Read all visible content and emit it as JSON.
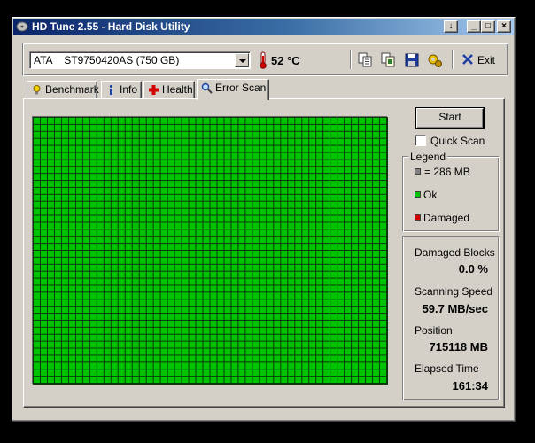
{
  "window": {
    "title": "HD Tune 2.55 - Hard Disk Utility",
    "title_buttons": [
      "↓",
      "_",
      "□",
      "×"
    ]
  },
  "toolbar": {
    "drive": "ATA    ST9750420AS (750 GB)",
    "temperature": "52 °C",
    "exit_label": "Exit",
    "icons": [
      "copy-text-icon",
      "copy-info-icon",
      "save-icon",
      "options-icon",
      "exit-icon"
    ]
  },
  "tabs": [
    {
      "label": "Benchmark",
      "icon": "benchmark-icon",
      "active": false
    },
    {
      "label": "Info",
      "icon": "info-icon",
      "active": false
    },
    {
      "label": "Health",
      "icon": "health-cross-icon",
      "active": false
    },
    {
      "label": "Error Scan",
      "icon": "magnifier-icon",
      "active": true
    }
  ],
  "scan": {
    "start_label": "Start",
    "quick_scan_label": "Quick Scan",
    "quick_scan_checked": false,
    "grid": {
      "columns": 50,
      "rows": 38,
      "status": "Ok",
      "block_color": "#00c400"
    }
  },
  "legend": {
    "title": "Legend",
    "items": [
      {
        "label": "= 286 MB",
        "color": "#808080"
      },
      {
        "label": "Ok",
        "color": "#00c400"
      },
      {
        "label": "Damaged",
        "color": "#d40000"
      }
    ]
  },
  "stats": [
    {
      "label": "Damaged Blocks",
      "value": "0.0 %"
    },
    {
      "label": "Scanning Speed",
      "value": "59.7 MB/sec"
    },
    {
      "label": "Position",
      "value": "715118 MB"
    },
    {
      "label": "Elapsed Time",
      "value": "161:34"
    }
  ],
  "colors": {
    "title_bar": "#0a246a",
    "face": "#d4d0c8",
    "ok": "#00c400",
    "damaged": "#d40000"
  }
}
